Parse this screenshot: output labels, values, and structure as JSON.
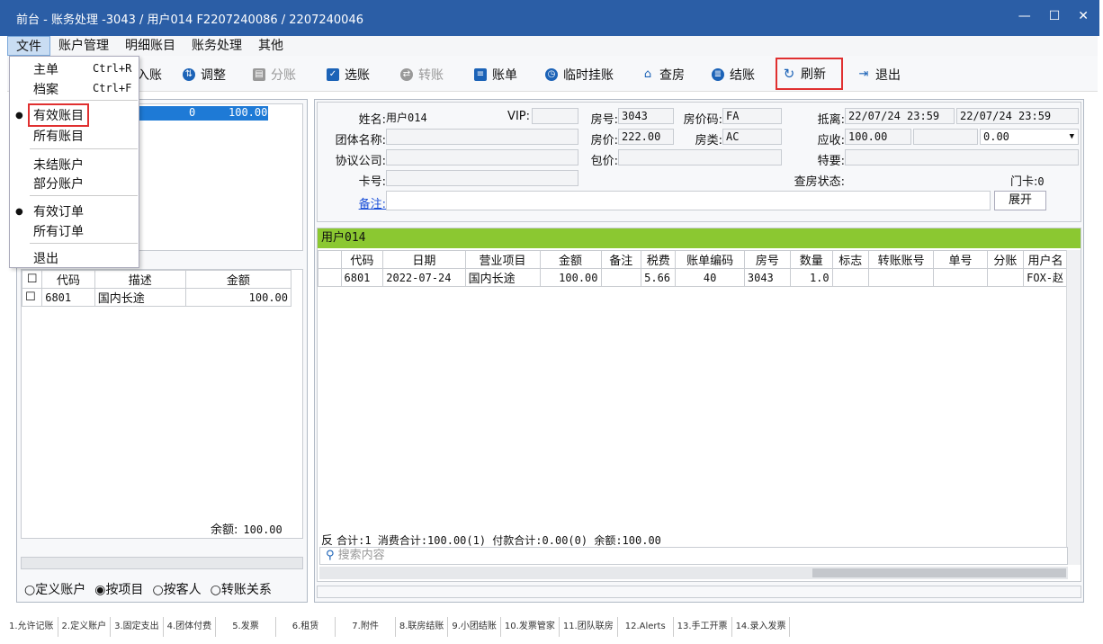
{
  "window": {
    "title": "前台 - 账务处理 -3043 / 用户014  F2207240086 / 2207240046",
    "min": "—",
    "max": "☐",
    "close": "✕"
  },
  "menu": [
    "文件",
    "账户管理",
    "明细账目",
    "账务处理",
    "其他"
  ],
  "file_menu": {
    "items": [
      {
        "label": "主单",
        "shortcut": "Ctrl+R"
      },
      {
        "label": "档案",
        "shortcut": "Ctrl+F"
      },
      {
        "label": "有效账目"
      },
      {
        "label": "所有账目"
      },
      {
        "label": "未结账户"
      },
      {
        "label": "部分账户"
      },
      {
        "label": "有效订单"
      },
      {
        "label": "所有订单"
      },
      {
        "label": "退出"
      }
    ]
  },
  "toolbar": {
    "ruzhang": "入账",
    "tiaozheng": "调整",
    "fenzhang": "分账",
    "xuanzhang": "选账",
    "zhuanzhang": "转账",
    "zhangdan": "账单",
    "linshi": "临时挂账",
    "chafang": "查房",
    "jiezhang": "结账",
    "shuaxin": "刷新",
    "tuichu": "退出"
  },
  "top_left_row": {
    "code": "0",
    "amount": "100.00"
  },
  "left_table": {
    "headers": [
      "代码",
      "描述",
      "金额"
    ],
    "rows": [
      {
        "code": "6801",
        "desc": "国内长途",
        "amount": "100.00"
      }
    ],
    "balance_label": "余额:",
    "balance": "100.00"
  },
  "view_options": [
    "定义账户",
    "按项目",
    "按客人",
    "转账关系"
  ],
  "guest": {
    "name_label": "姓名:",
    "name": "用户014",
    "vip_label": "VIP:",
    "vip": "",
    "room_label": "房号:",
    "room": "3043",
    "ratecode_label": "房价码:",
    "ratecode": "FA",
    "depart_label": "抵离:",
    "arrive_date": "22/07/24 23:59",
    "depart_date": "22/07/24 23:59",
    "group_label": "团体名称:",
    "rate_label": "房价:",
    "rate": "222.00",
    "roomtype_label": "房类:",
    "roomtype": "AC",
    "receivable_label": "应收:",
    "receivable": "100.00",
    "receivable2": "0.00",
    "company_label": "协议公司:",
    "package_label": "包价:",
    "special_label": "特要:",
    "card_label": "卡号:",
    "status_label": "查房状态:",
    "doorcard_label": "门卡:",
    "doorcard": "0",
    "remark_label": "备注:",
    "expand": "展开"
  },
  "account_header": "用户014",
  "detail_table": {
    "headers": [
      "代码",
      "日期",
      "营业项目",
      "金额",
      "备注",
      "税费",
      "账单编码",
      "房号",
      "数量",
      "标志",
      "转账账号",
      "单号",
      "分账",
      "用户名"
    ],
    "rows": [
      [
        "6801",
        "2022-07-24",
        "国内长途",
        "100.00",
        "",
        "5.66",
        "40",
        "3043",
        "1.0",
        "",
        "",
        "",
        "",
        "FOX-赵"
      ]
    ]
  },
  "summary": {
    "reverse": "反",
    "text": "合计:1  消费合计:100.00(1)  付款合计:0.00(0)  余额:100.00"
  },
  "search": {
    "placeholder": "搜索内容"
  },
  "status_tabs": [
    "1.允许记账",
    "2.定义账户",
    "3.固定支出",
    "4.团体付费",
    "5.发票",
    "6.租赁",
    "7.附件",
    "8.联房结账",
    "9.小团结账",
    "10.发票管家",
    "11.团队联房",
    "12.Alerts",
    "13.手工开票",
    "14.录入发票"
  ]
}
